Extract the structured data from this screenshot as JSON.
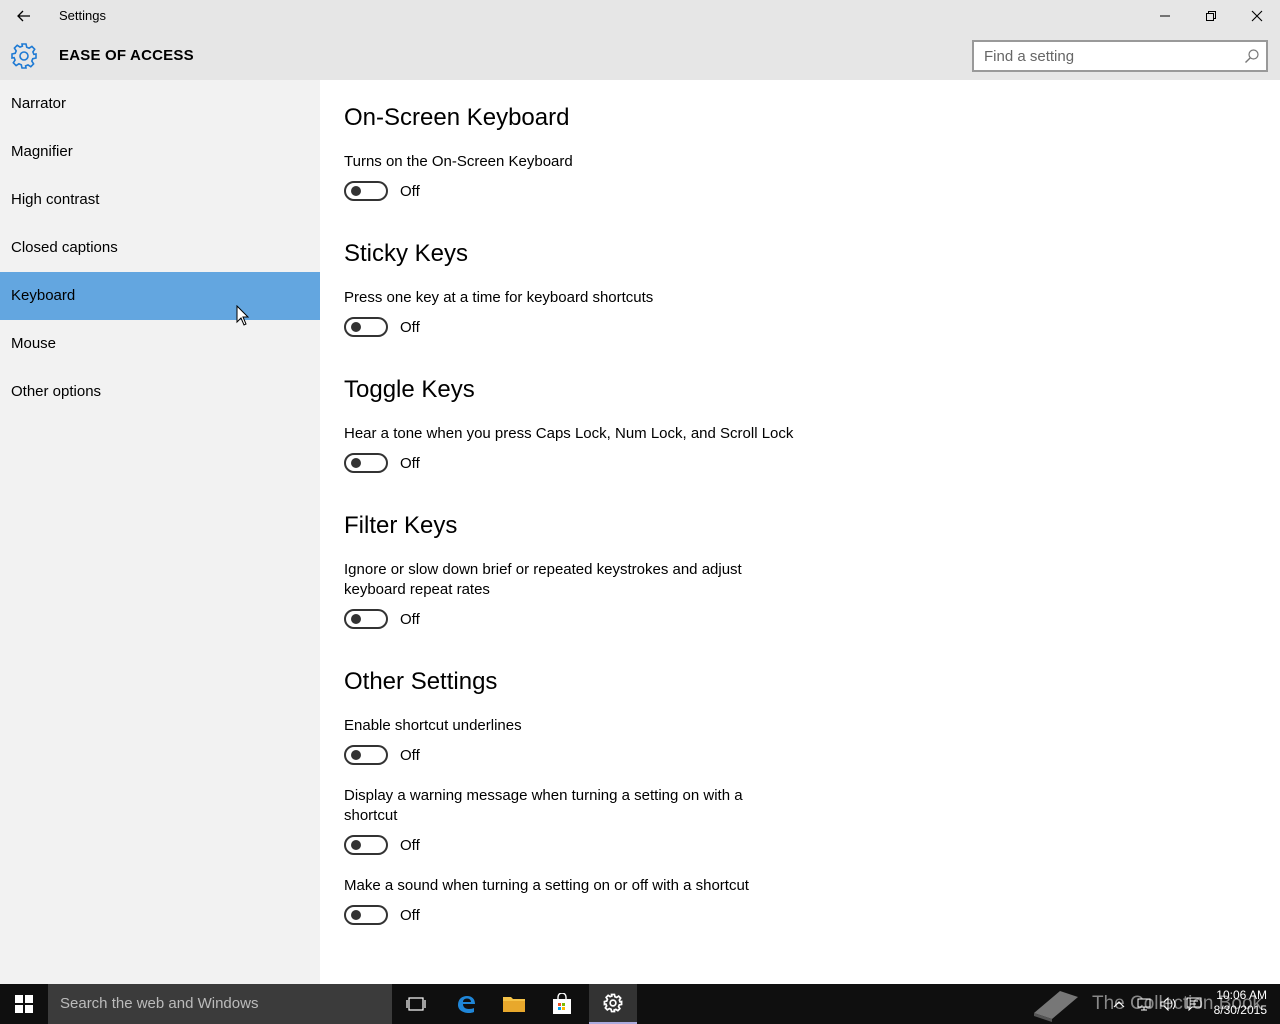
{
  "window": {
    "title": "Settings"
  },
  "header": {
    "section_title": "EASE OF ACCESS",
    "search_placeholder": "Find a setting"
  },
  "sidebar": {
    "items": [
      {
        "label": "Narrator",
        "active": false
      },
      {
        "label": "Magnifier",
        "active": false
      },
      {
        "label": "High contrast",
        "active": false
      },
      {
        "label": "Closed captions",
        "active": false
      },
      {
        "label": "Keyboard",
        "active": true
      },
      {
        "label": "Mouse",
        "active": false
      },
      {
        "label": "Other options",
        "active": false
      }
    ]
  },
  "main": {
    "on_screen_keyboard": {
      "title": "On-Screen Keyboard",
      "desc": "Turns on the On-Screen Keyboard",
      "state": "Off"
    },
    "sticky_keys": {
      "title": "Sticky Keys",
      "desc": "Press one key at a time for keyboard shortcuts",
      "state": "Off"
    },
    "toggle_keys": {
      "title": "Toggle Keys",
      "desc": "Hear a tone when you press Caps Lock, Num Lock, and Scroll Lock",
      "state": "Off"
    },
    "filter_keys": {
      "title": "Filter Keys",
      "desc": "Ignore or slow down brief or repeated keystrokes and adjust keyboard repeat rates",
      "state": "Off"
    },
    "other_settings": {
      "title": "Other Settings",
      "shortcut_underlines": {
        "desc": "Enable shortcut underlines",
        "state": "Off"
      },
      "warning_message": {
        "desc": "Display a warning message when turning a setting on with a shortcut",
        "state": "Off"
      },
      "make_sound": {
        "desc": "Make a sound when turning a setting on or off with a shortcut",
        "state": "Off"
      }
    }
  },
  "taskbar": {
    "search_placeholder": "Search the web and Windows",
    "time": "10:06 AM",
    "date": "8/30/2015",
    "watermark": "The Collection Book"
  },
  "colors": {
    "accent": "#63a6e0",
    "chrome": "#e6e6e6",
    "sidebar": "#f2f2f2",
    "taskbar": "#0f0f0f",
    "gear": "#1e7ad4"
  }
}
